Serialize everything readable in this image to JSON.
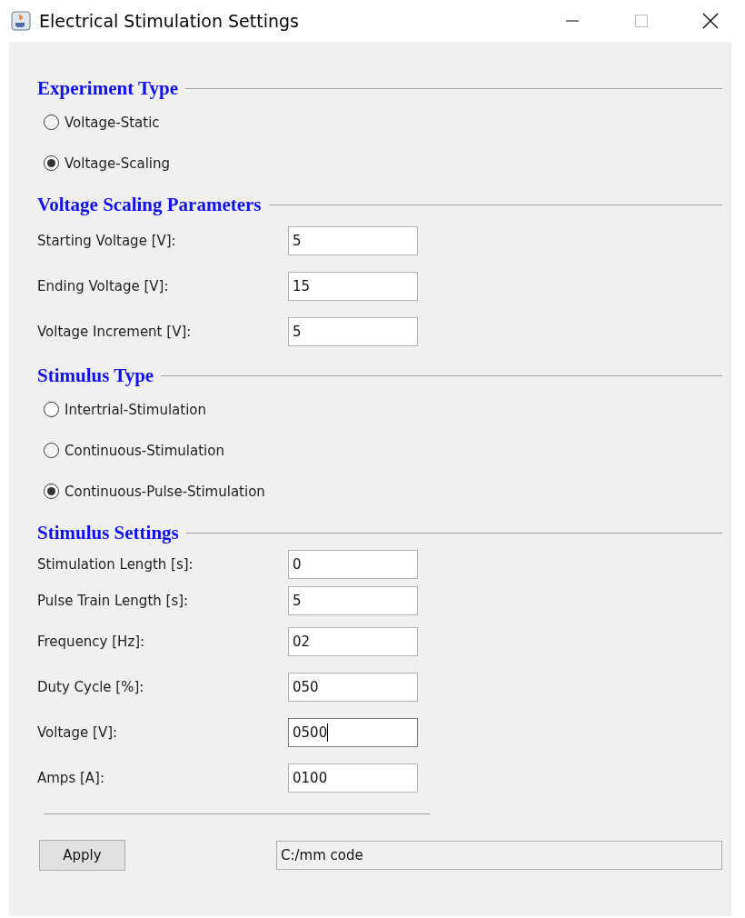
{
  "window": {
    "title": "Electrical Stimulation Settings"
  },
  "sections": [
    {
      "kind": "radios",
      "heading": "Experiment Type",
      "options": [
        {
          "label": "Voltage-Static",
          "selected": false
        },
        {
          "label": "Voltage-Scaling",
          "selected": true
        }
      ]
    },
    {
      "kind": "fields",
      "heading": "Voltage Scaling Parameters",
      "fields": [
        {
          "label": "Starting Voltage [V]:",
          "value": "5",
          "focused": false
        },
        {
          "label": "Ending Voltage [V]:",
          "value": "15",
          "focused": false
        },
        {
          "label": "Voltage Increment [V]:",
          "value": "5",
          "focused": false
        }
      ]
    },
    {
      "kind": "radios",
      "heading": "Stimulus Type",
      "options": [
        {
          "label": "Intertrial-Stimulation",
          "selected": false
        },
        {
          "label": "Continuous-Stimulation",
          "selected": false
        },
        {
          "label": "Continuous-Pulse-Stimulation",
          "selected": true
        }
      ]
    },
    {
      "kind": "fields",
      "heading": "Stimulus Settings",
      "fields": [
        {
          "label": "Stimulation Length [s]:",
          "value": "0",
          "focused": false
        },
        {
          "label": "Pulse Train Length [s]:",
          "value": "5",
          "focused": false
        },
        {
          "label": "Frequency [Hz]:",
          "value": "02",
          "focused": false
        },
        {
          "label": "Duty Cycle [%]:",
          "value": "050",
          "focused": false
        },
        {
          "label": "Voltage [V]:",
          "value": "0500",
          "focused": true
        },
        {
          "label": "Amps [A]:",
          "value": "0100",
          "focused": false
        }
      ]
    }
  ],
  "apply_button": "Apply",
  "path_field": {
    "value": "C:/mm code"
  }
}
